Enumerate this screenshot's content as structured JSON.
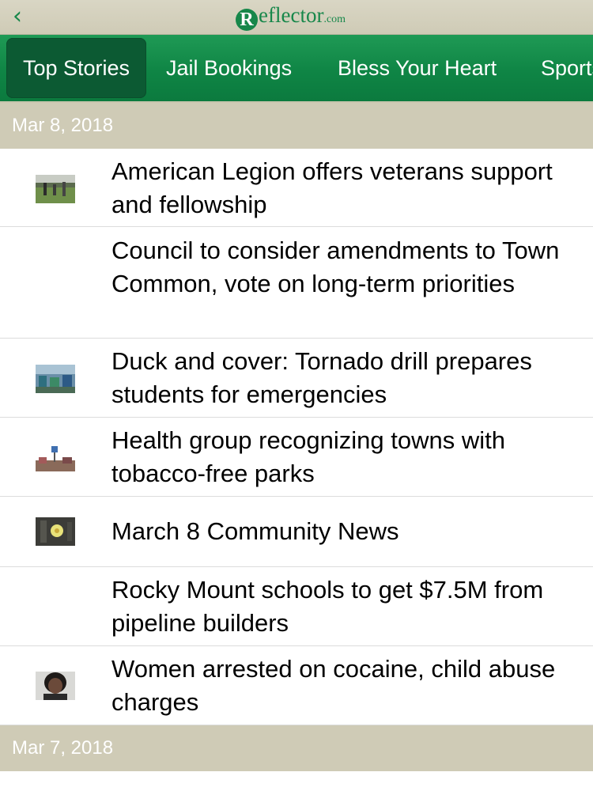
{
  "header": {
    "logo_letter": "R",
    "logo_text": "eflector",
    "logo_suffix": ".com",
    "back_icon": "chevron-left-icon",
    "accent_color": "#17874a"
  },
  "tabs": [
    {
      "label": "Top Stories",
      "active": true
    },
    {
      "label": "Jail Bookings",
      "active": false
    },
    {
      "label": "Bless Your Heart",
      "active": false
    },
    {
      "label": "Sports",
      "active": false
    }
  ],
  "sections": [
    {
      "date": "Mar 8, 2018",
      "stories": [
        {
          "title": "American Legion offers veterans support and fellowship",
          "thumbnail": "field-photo"
        },
        {
          "title": "Council to consider amendments to Town Common, vote on long-term priorities",
          "thumbnail": null
        },
        {
          "title": "Duck and cover: Tornado drill prepares students for emergencies",
          "thumbnail": "classroom-photo"
        },
        {
          "title": "Health group recognizing towns with tobacco-free parks",
          "thumbnail": "park-sign-photo"
        },
        {
          "title": "March 8 Community News",
          "thumbnail": "flower-photo"
        },
        {
          "title": "Rocky Mount schools to get $7.5M from pipeline builders",
          "thumbnail": null
        },
        {
          "title": "Women arrested on cocaine, child abuse charges",
          "thumbnail": "mugshot-photo"
        }
      ]
    },
    {
      "date": "Mar 7, 2018",
      "stories": []
    }
  ]
}
